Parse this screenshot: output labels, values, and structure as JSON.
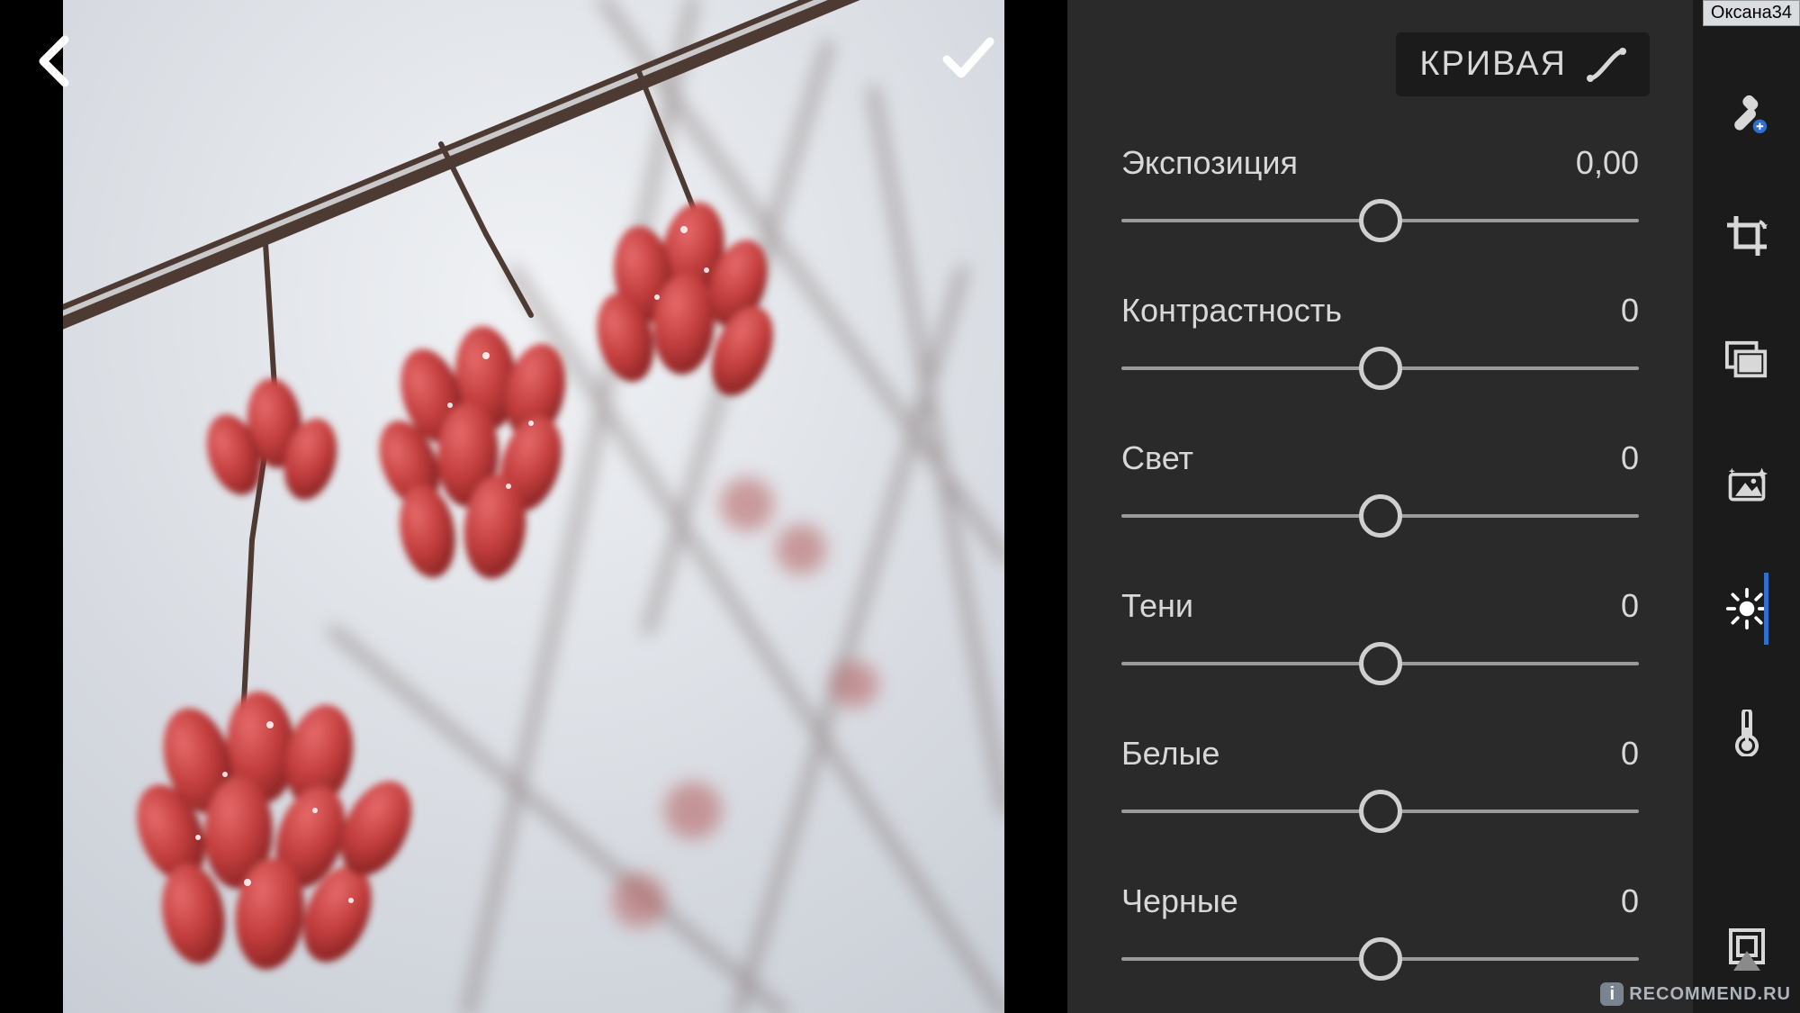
{
  "user_tag": "Оксана34",
  "watermark": "RECOMMEND.RU",
  "panel": {
    "curve_button": "КРИВАЯ",
    "sliders": [
      {
        "label": "Экспозиция",
        "value": "0,00"
      },
      {
        "label": "Контрастность",
        "value": "0"
      },
      {
        "label": "Свет",
        "value": "0"
      },
      {
        "label": "Тени",
        "value": "0"
      },
      {
        "label": "Белые",
        "value": "0"
      },
      {
        "label": "Черные",
        "value": "0"
      }
    ]
  },
  "tools": {
    "healing": "healing-brush-icon",
    "crop": "crop-icon",
    "presets": "presets-icon",
    "autofix": "auto-enhance-icon",
    "light": "light-icon",
    "color": "color-temperature-icon",
    "fullscreen": "fullscreen-icon"
  }
}
